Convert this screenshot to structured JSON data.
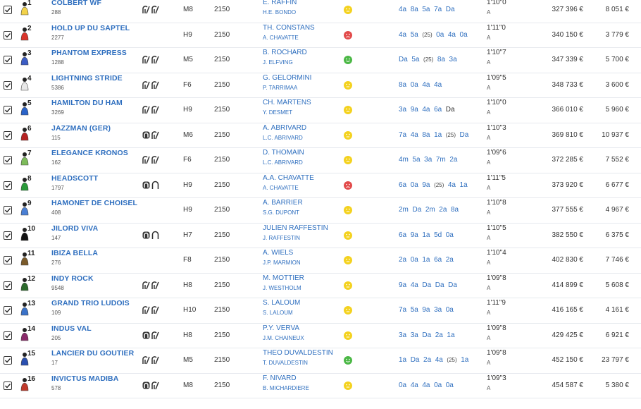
{
  "colors": {
    "link": "#2f6fbf",
    "mood_yellow": "#f4d21f",
    "mood_red": "#e24b4b",
    "mood_green": "#4cb846"
  },
  "rows": [
    {
      "num": "1",
      "name": "COLBERT WF",
      "sub": "288",
      "shoes": [
        "shoe-d4-icon",
        "shoe-d4-icon"
      ],
      "cat": "M8",
      "dist": "2150",
      "driver": "E. RAFFIN",
      "trainer": "H.E. BONDO",
      "mood": "yellow",
      "music": [
        {
          "t": "4a"
        },
        {
          "t": "8a"
        },
        {
          "t": "5a"
        },
        {
          "t": "7a"
        },
        {
          "t": "Da"
        }
      ],
      "rec": "1'10\"0",
      "rec_sub": "A",
      "gains": "327 396 €",
      "prize": "8 051 €",
      "jcolor": "#f2d24a"
    },
    {
      "num": "2",
      "name": "HOLD UP DU SAPTEL",
      "sub": "2277",
      "shoes": [],
      "cat": "H9",
      "dist": "2150",
      "driver": "TH. CONSTANS",
      "trainer": "A. CHAVATTE",
      "mood": "red",
      "music": [
        {
          "t": "4a"
        },
        {
          "t": "5a"
        },
        {
          "t": "(25)",
          "y": 1
        },
        {
          "t": "0a"
        },
        {
          "t": "4a"
        },
        {
          "t": "0a"
        }
      ],
      "rec": "1'11\"0",
      "rec_sub": "A",
      "gains": "340 150 €",
      "prize": "3 779 €",
      "jcolor": "#d9342b"
    },
    {
      "num": "3",
      "name": "PHANTOM EXPRESS",
      "sub": "1288",
      "shoes": [
        "shoe-d4-icon",
        "shoe-d4-icon"
      ],
      "cat": "M5",
      "dist": "2150",
      "driver": "B. ROCHARD",
      "trainer": "J. ELFVING",
      "mood": "green",
      "music": [
        {
          "t": "Da"
        },
        {
          "t": "5a"
        },
        {
          "t": "(25)",
          "y": 1
        },
        {
          "t": "8a"
        },
        {
          "t": "3a"
        }
      ],
      "rec": "1'10\"7",
      "rec_sub": "A",
      "gains": "347 339 €",
      "prize": "5 700 €",
      "jcolor": "#3b5cc4"
    },
    {
      "num": "4",
      "name": "LIGHTNING STRIDE",
      "sub": "5386",
      "shoes": [
        "shoe-d4-icon",
        "shoe-d4-icon"
      ],
      "cat": "F6",
      "dist": "2150",
      "driver": "G. GELORMINI",
      "trainer": "P. TARRIMAA",
      "mood": "yellow",
      "music": [
        {
          "t": "8a"
        },
        {
          "t": "0a"
        },
        {
          "t": "4a"
        },
        {
          "t": "4a"
        }
      ],
      "rec": "1'09\"5",
      "rec_sub": "A",
      "gains": "348 733 €",
      "prize": "3 600 €",
      "jcolor": "#e8e8e8"
    },
    {
      "num": "5",
      "name": "HAMILTON DU HAM",
      "sub": "3269",
      "shoes": [
        "shoe-d4-icon",
        "shoe-d4-icon"
      ],
      "cat": "H9",
      "dist": "2150",
      "driver": "CH. MARTENS",
      "trainer": "Y. DESMET",
      "mood": "yellow",
      "music": [
        {
          "t": "3a"
        },
        {
          "t": "9a"
        },
        {
          "t": "4a"
        },
        {
          "t": "6a"
        },
        {
          "t": "Da",
          "d": 1
        }
      ],
      "rec": "1'10\"0",
      "rec_sub": "A",
      "gains": "366 010 €",
      "prize": "5 960 €",
      "jcolor": "#2a63c9"
    },
    {
      "num": "6",
      "name": "JAZZMAN (GER)",
      "sub": "115",
      "shoes": [
        "shoe-da-icon",
        "shoe-d4-icon"
      ],
      "cat": "M6",
      "dist": "2150",
      "driver": "A. ABRIVARD",
      "trainer": "L.C. ABRIVARD",
      "mood": "yellow",
      "music": [
        {
          "t": "7a"
        },
        {
          "t": "4a"
        },
        {
          "t": "8a"
        },
        {
          "t": "1a"
        },
        {
          "t": "(25)",
          "y": 1
        },
        {
          "t": "Da"
        }
      ],
      "rec": "1'10\"3",
      "rec_sub": "A",
      "gains": "369 810 €",
      "prize": "10 937 €",
      "jcolor": "#b52222"
    },
    {
      "num": "7",
      "name": "ELEGANCE KRONOS",
      "sub": "162",
      "shoes": [
        "shoe-d4-icon",
        "shoe-d4-icon"
      ],
      "cat": "F6",
      "dist": "2150",
      "driver": "D. THOMAIN",
      "trainer": "L.C. ABRIVARD",
      "mood": "yellow",
      "music": [
        {
          "t": "4m"
        },
        {
          "t": "5a"
        },
        {
          "t": "3a"
        },
        {
          "t": "7m"
        },
        {
          "t": "2a"
        }
      ],
      "rec": "1'09\"6",
      "rec_sub": "A",
      "gains": "372 285 €",
      "prize": "7 552 €",
      "jcolor": "#7dbb5a"
    },
    {
      "num": "8",
      "name": "HEADSCOTT",
      "sub": "1797",
      "shoes": [
        "shoe-da-icon",
        "shoe-pa-icon"
      ],
      "cat": "H9",
      "dist": "2150",
      "driver": "A.A. CHAVATTE",
      "trainer": "A. CHAVATTE",
      "mood": "red",
      "music": [
        {
          "t": "6a"
        },
        {
          "t": "0a"
        },
        {
          "t": "9a"
        },
        {
          "t": "(25)",
          "y": 1
        },
        {
          "t": "4a"
        },
        {
          "t": "1a"
        }
      ],
      "rec": "1'11\"5",
      "rec_sub": "A",
      "gains": "373 920 €",
      "prize": "6 677 €",
      "jcolor": "#2a9a3a"
    },
    {
      "num": "9",
      "name": "HAMONET DE CHOISEL",
      "sub": "408",
      "shoes": [],
      "cat": "H9",
      "dist": "2150",
      "driver": "A. BARRIER",
      "trainer": "S.G. DUPONT",
      "mood": "yellow",
      "music": [
        {
          "t": "2m"
        },
        {
          "t": "Da"
        },
        {
          "t": "2m"
        },
        {
          "t": "2a"
        },
        {
          "t": "8a"
        }
      ],
      "rec": "1'10\"8",
      "rec_sub": "A",
      "gains": "377 555 €",
      "prize": "4 967 €",
      "jcolor": "#4a7fd4"
    },
    {
      "num": "10",
      "name": "JILORD VIVA",
      "sub": "147",
      "shoes": [
        "shoe-da-icon",
        "shoe-pa-icon"
      ],
      "cat": "H7",
      "dist": "2150",
      "driver": "JULIEN RAFFESTIN",
      "trainer": "J. RAFFESTIN",
      "mood": "yellow",
      "music": [
        {
          "t": "6a"
        },
        {
          "t": "9a"
        },
        {
          "t": "1a"
        },
        {
          "t": "5d"
        },
        {
          "t": "0a"
        }
      ],
      "rec": "1'10\"5",
      "rec_sub": "A",
      "gains": "382 550 €",
      "prize": "6 375 €",
      "jcolor": "#111111"
    },
    {
      "num": "11",
      "name": "IBIZA BELLA",
      "sub": "276",
      "shoes": [],
      "cat": "F8",
      "dist": "2150",
      "driver": "A. WIELS",
      "trainer": "J.P. MARMION",
      "mood": "yellow",
      "music": [
        {
          "t": "2a"
        },
        {
          "t": "0a"
        },
        {
          "t": "1a"
        },
        {
          "t": "6a"
        },
        {
          "t": "2a"
        }
      ],
      "rec": "1'10\"4",
      "rec_sub": "A",
      "gains": "402 830 €",
      "prize": "7 746 €",
      "jcolor": "#7a5a2a"
    },
    {
      "num": "12",
      "name": "INDY ROCK",
      "sub": "9548",
      "shoes": [
        "shoe-d4-icon",
        "shoe-d4-icon"
      ],
      "cat": "H8",
      "dist": "2150",
      "driver": "M. MOTTIER",
      "trainer": "J. WESTHOLM",
      "mood": "yellow",
      "music": [
        {
          "t": "9a"
        },
        {
          "t": "4a"
        },
        {
          "t": "Da"
        },
        {
          "t": "Da"
        },
        {
          "t": "Da"
        }
      ],
      "rec": "1'09\"8",
      "rec_sub": "A",
      "gains": "414 899 €",
      "prize": "5 608 €",
      "jcolor": "#2c6a2c"
    },
    {
      "num": "13",
      "name": "GRAND TRIO LUDOIS",
      "sub": "109",
      "shoes": [
        "shoe-d4-icon",
        "shoe-d4-icon"
      ],
      "cat": "H10",
      "dist": "2150",
      "driver": "S. LALOUM",
      "trainer": "S. LALOUM",
      "mood": "yellow",
      "music": [
        {
          "t": "7a"
        },
        {
          "t": "5a"
        },
        {
          "t": "9a"
        },
        {
          "t": "3a"
        },
        {
          "t": "0a"
        }
      ],
      "rec": "1'11\"9",
      "rec_sub": "A",
      "gains": "416 165 €",
      "prize": "4 161 €",
      "jcolor": "#3a72c8"
    },
    {
      "num": "14",
      "name": "INDUS VAL",
      "sub": "205",
      "shoes": [
        "shoe-da-icon",
        "shoe-d4-icon"
      ],
      "cat": "H8",
      "dist": "2150",
      "driver": "P.Y. VERVA",
      "trainer": "J.M. CHAINEUX",
      "mood": "yellow",
      "music": [
        {
          "t": "3a"
        },
        {
          "t": "3a"
        },
        {
          "t": "Da"
        },
        {
          "t": "2a"
        },
        {
          "t": "1a"
        }
      ],
      "rec": "1'09\"8",
      "rec_sub": "A",
      "gains": "429 425 €",
      "prize": "6 921 €",
      "jcolor": "#8a2a6a"
    },
    {
      "num": "15",
      "name": "LANCIER DU GOUTIER",
      "sub": "17",
      "shoes": [
        "shoe-d4-icon",
        "shoe-d4-icon"
      ],
      "cat": "M5",
      "dist": "2150",
      "driver": "THEO DUVALDESTIN",
      "trainer": "T. DUVALDESTIN",
      "mood": "green",
      "music": [
        {
          "t": "1a"
        },
        {
          "t": "Da"
        },
        {
          "t": "2a"
        },
        {
          "t": "4a"
        },
        {
          "t": "(25)",
          "y": 1
        },
        {
          "t": "1a"
        }
      ],
      "rec": "1'09\"8",
      "rec_sub": "A",
      "gains": "452 150 €",
      "prize": "23 797 €",
      "jcolor": "#2a4fb0"
    },
    {
      "num": "16",
      "name": "INVICTUS MADIBA",
      "sub": "578",
      "shoes": [
        "shoe-da-icon",
        "shoe-d4-icon"
      ],
      "cat": "M8",
      "dist": "2150",
      "driver": "F. NIVARD",
      "trainer": "B. MICHARDIERE",
      "mood": "yellow",
      "music": [
        {
          "t": "0a"
        },
        {
          "t": "4a"
        },
        {
          "t": "4a"
        },
        {
          "t": "0a"
        },
        {
          "t": "0a"
        }
      ],
      "rec": "1'09\"3",
      "rec_sub": "A",
      "gains": "454 587 €",
      "prize": "5 380 €",
      "jcolor": "#c0392b"
    }
  ]
}
